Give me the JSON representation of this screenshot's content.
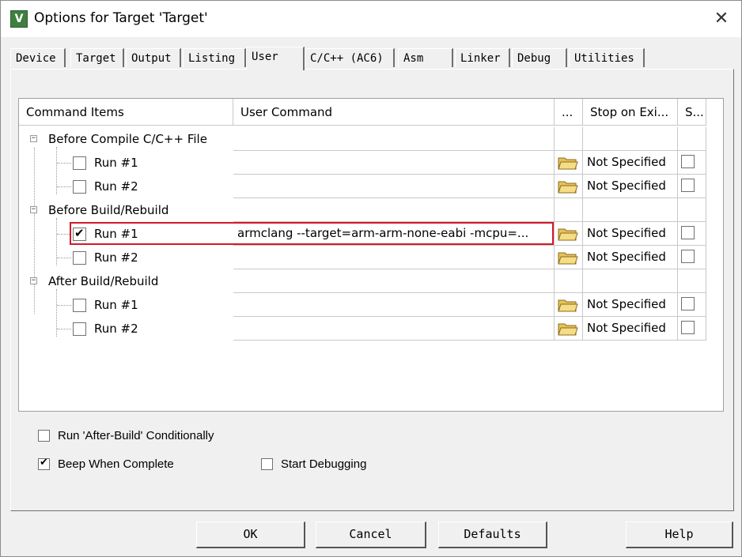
{
  "window": {
    "title": "Options for Target 'Target'",
    "close_glyph": "✕",
    "app_icon_glyph": "V"
  },
  "tabs": [
    {
      "label": "Device"
    },
    {
      "label": "Target"
    },
    {
      "label": "Output"
    },
    {
      "label": "Listing"
    },
    {
      "label": "User",
      "active": true
    },
    {
      "label": "C/C++ (AC6)"
    },
    {
      "label": "Asm"
    },
    {
      "label": "Linker"
    },
    {
      "label": "Debug"
    },
    {
      "label": "Utilities"
    }
  ],
  "grid": {
    "headers": {
      "items": "Command Items",
      "command": "User Command",
      "browse": "...",
      "stop": "Stop on Exi...",
      "s": "S..."
    },
    "groups": [
      {
        "label": "Before Compile C/C++ File",
        "expander": "−",
        "runs": [
          {
            "label": "Run #1",
            "checked": false,
            "command": "",
            "stop": "Not Specified"
          },
          {
            "label": "Run #2",
            "checked": false,
            "command": "",
            "stop": "Not Specified"
          }
        ]
      },
      {
        "label": "Before Build/Rebuild",
        "expander": "−",
        "runs": [
          {
            "label": "Run #1",
            "checked": true,
            "command": "armclang --target=arm-arm-none-eabi -mcpu=...",
            "stop": "Not Specified"
          },
          {
            "label": "Run #2",
            "checked": false,
            "command": "",
            "stop": "Not Specified"
          }
        ]
      },
      {
        "label": "After Build/Rebuild",
        "expander": "−",
        "runs": [
          {
            "label": "Run #1",
            "checked": false,
            "command": "",
            "stop": "Not Specified"
          },
          {
            "label": "Run #2",
            "checked": false,
            "command": "",
            "stop": "Not Specified"
          }
        ]
      }
    ]
  },
  "options": {
    "run_after_build": {
      "label": "Run 'After-Build' Conditionally",
      "checked": false
    },
    "beep": {
      "label": "Beep When Complete",
      "checked": true
    },
    "start_debugging": {
      "label": "Start Debugging",
      "checked": false
    }
  },
  "buttons": {
    "ok": "OK",
    "cancel": "Cancel",
    "defaults": "Defaults",
    "help": "Help"
  }
}
